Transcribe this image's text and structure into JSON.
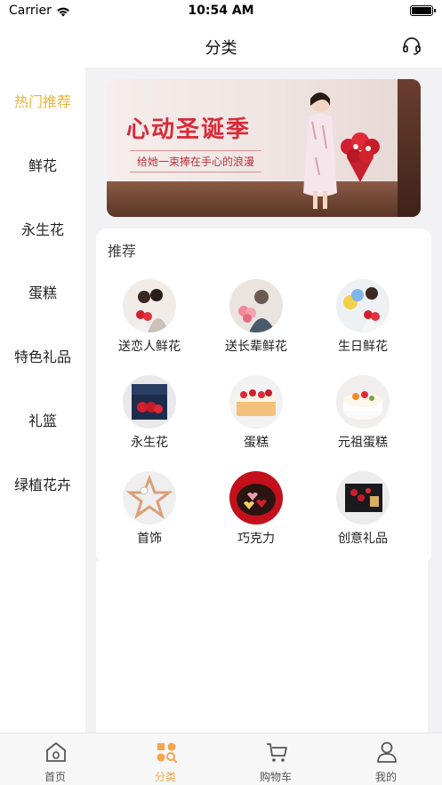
{
  "status_bar": {
    "carrier": "Carrier",
    "time": "10:54 AM"
  },
  "nav": {
    "title": "分类",
    "support_icon": "headset-icon"
  },
  "sidebar": {
    "items": [
      {
        "label": "热门推荐",
        "active": true
      },
      {
        "label": "鲜花",
        "active": false
      },
      {
        "label": "永生花",
        "active": false
      },
      {
        "label": "蛋糕",
        "active": false
      },
      {
        "label": "特色礼品",
        "active": false
      },
      {
        "label": "礼篮",
        "active": false
      },
      {
        "label": "绿植花卉",
        "active": false
      }
    ],
    "active_color": "#f0b432"
  },
  "banner": {
    "title": "心动圣诞季",
    "subtitle": "给她一束捧在手心的浪漫"
  },
  "recommend": {
    "title": "推荐",
    "items": [
      {
        "label": "送恋人鲜花"
      },
      {
        "label": "送长辈鲜花"
      },
      {
        "label": "生日鲜花"
      },
      {
        "label": "永生花"
      },
      {
        "label": "蛋糕"
      },
      {
        "label": "元祖蛋糕"
      },
      {
        "label": "首饰"
      },
      {
        "label": "巧克力"
      },
      {
        "label": "创意礼品"
      }
    ]
  },
  "tab_bar": {
    "tabs": [
      {
        "label": "首页",
        "icon": "home-icon",
        "active": false
      },
      {
        "label": "分类",
        "icon": "category-icon",
        "active": true
      },
      {
        "label": "购物车",
        "icon": "cart-icon",
        "active": false
      },
      {
        "label": "我的",
        "icon": "user-icon",
        "active": false
      }
    ],
    "active_color": "#f5a54a"
  }
}
